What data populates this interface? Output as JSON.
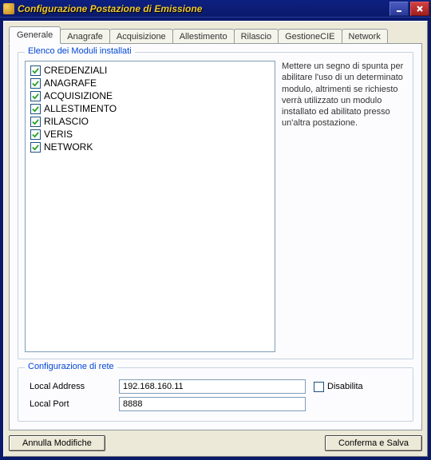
{
  "window": {
    "title": "Configurazione Postazione di Emissione"
  },
  "tabs": [
    {
      "label": "Generale",
      "active": true
    },
    {
      "label": "Anagrafe"
    },
    {
      "label": "Acquisizione"
    },
    {
      "label": "Allestimento"
    },
    {
      "label": "Rilascio"
    },
    {
      "label": "GestioneCIE"
    },
    {
      "label": "Network"
    }
  ],
  "modules_group": {
    "legend": "Elenco dei Moduli installati",
    "items": [
      {
        "label": "CREDENZIALI",
        "checked": true
      },
      {
        "label": "ANAGRAFE",
        "checked": true
      },
      {
        "label": "ACQUISIZIONE",
        "checked": true
      },
      {
        "label": "ALLESTIMENTO",
        "checked": true
      },
      {
        "label": "RILASCIO",
        "checked": true
      },
      {
        "label": "VERIS",
        "checked": true
      },
      {
        "label": "NETWORK",
        "checked": true
      }
    ],
    "description": "Mettere un segno di spunta per abilitare l'uso di un determinato modulo, altrimenti se richiesto verrà utilizzato un modulo installato ed abilitato presso un'altra postazione."
  },
  "network_group": {
    "legend": "Configurazione di rete",
    "address_label": "Local Address",
    "address_value": "192.168.160.11",
    "port_label": "Local Port",
    "port_value": "8888",
    "disable_label": "Disabilita",
    "disable_checked": false
  },
  "buttons": {
    "cancel": "Annulla Modifiche",
    "save": "Conferma e Salva"
  }
}
